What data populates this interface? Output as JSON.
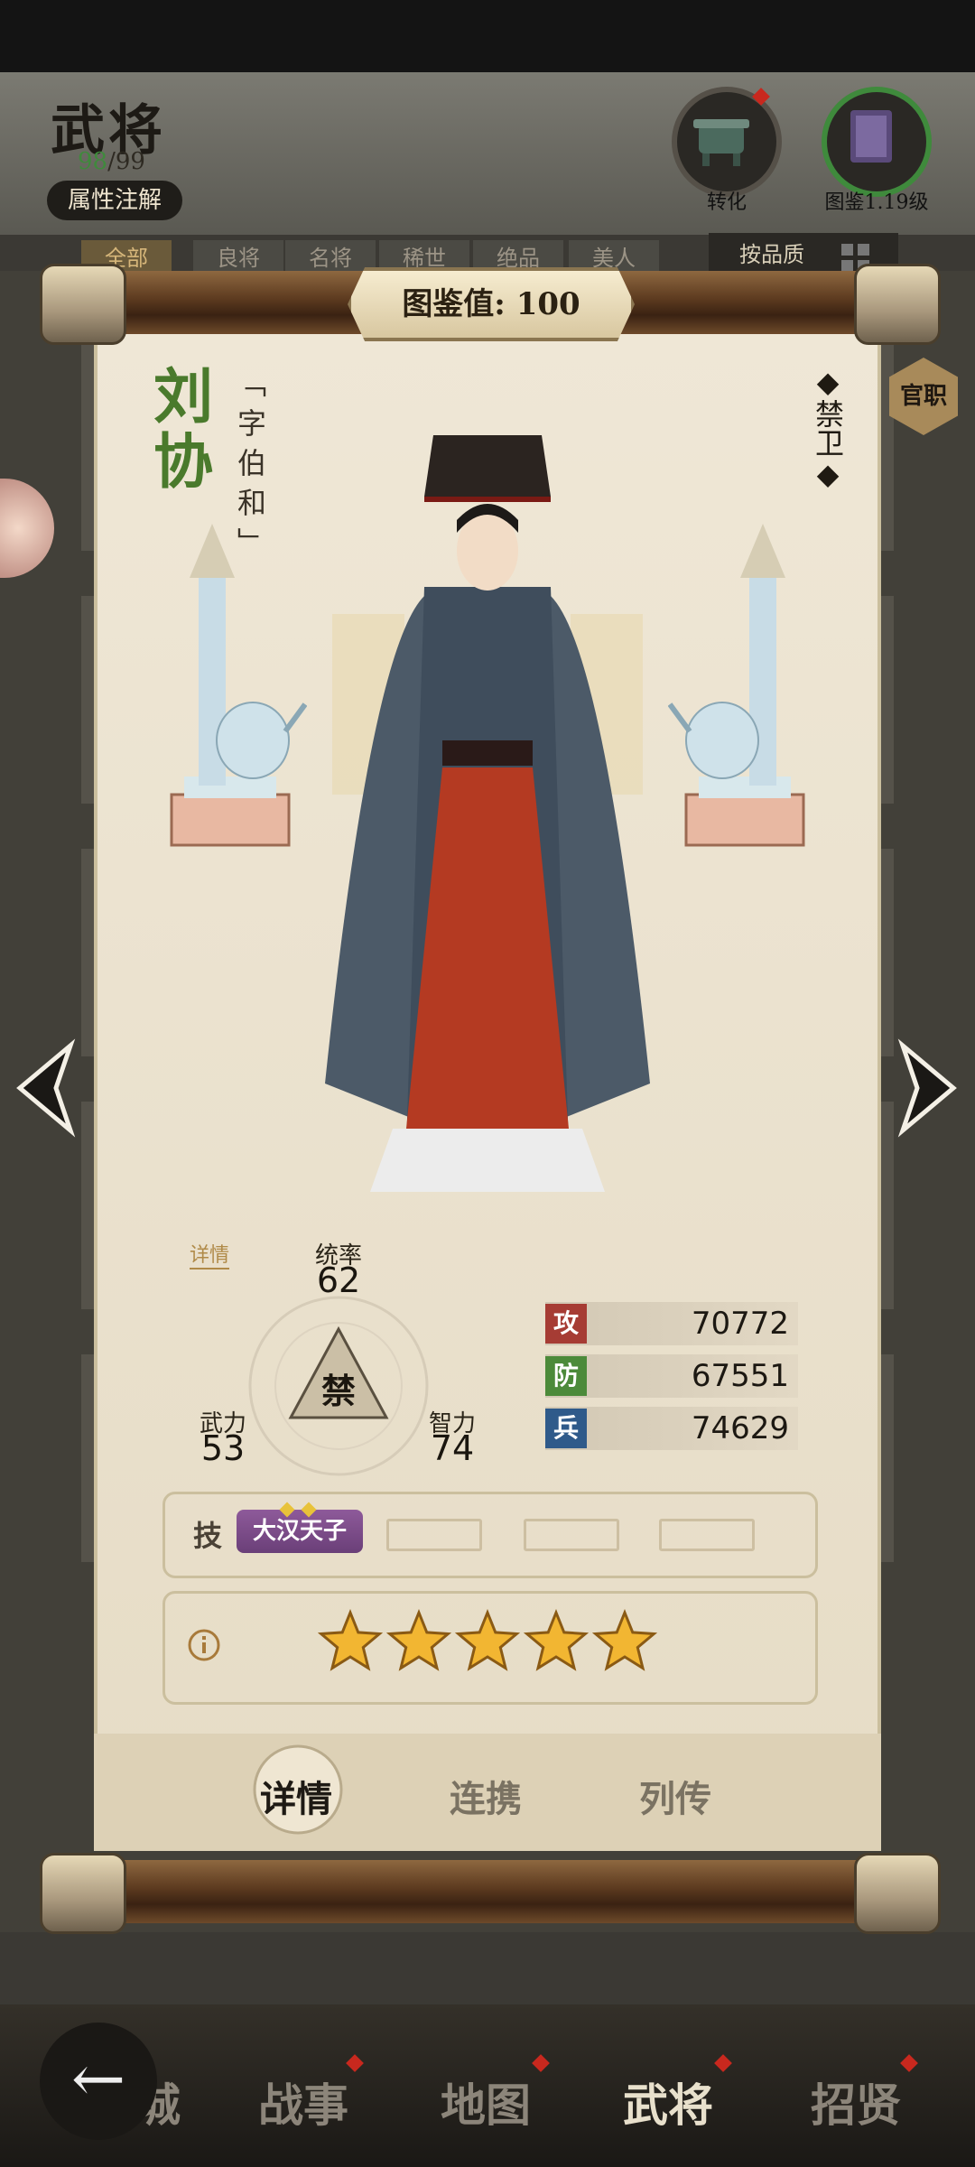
{
  "header": {
    "title": "武将",
    "count_current": "98",
    "count_total": "/99",
    "attr_note_button": "属性注解",
    "transform_button": "转化",
    "codex_button": "图鉴1.19级"
  },
  "filters": {
    "tabs": [
      "全部",
      "良将",
      "名将",
      "稀世",
      "绝品",
      "美人"
    ],
    "sort_button": "按品质"
  },
  "card": {
    "codex_value": "图鉴值: 100",
    "name": "刘协",
    "courtesy_name": "「字伯和」",
    "class": "◆禁卫◆",
    "official_button": "官职",
    "detail_link": "详情",
    "stats": {
      "command_label": "统率",
      "command_value": "62",
      "might_label": "武力",
      "might_value": "53",
      "intel_label": "智力",
      "intel_value": "74",
      "triangle_label": "禁"
    },
    "attributes": [
      {
        "icon": "攻",
        "value": "70772",
        "color": "#a63c34"
      },
      {
        "icon": "防",
        "value": "67551",
        "color": "#4c8a3a"
      },
      {
        "icon": "兵",
        "value": "74629",
        "color": "#2f5a8a"
      }
    ],
    "skill_label": "技",
    "skill_name": "大汉天子",
    "star_count": 5,
    "tabs": [
      "详情",
      "连携",
      "列传"
    ]
  },
  "bottom_nav": [
    "城",
    "战事",
    "地图",
    "武将",
    "招贤"
  ]
}
